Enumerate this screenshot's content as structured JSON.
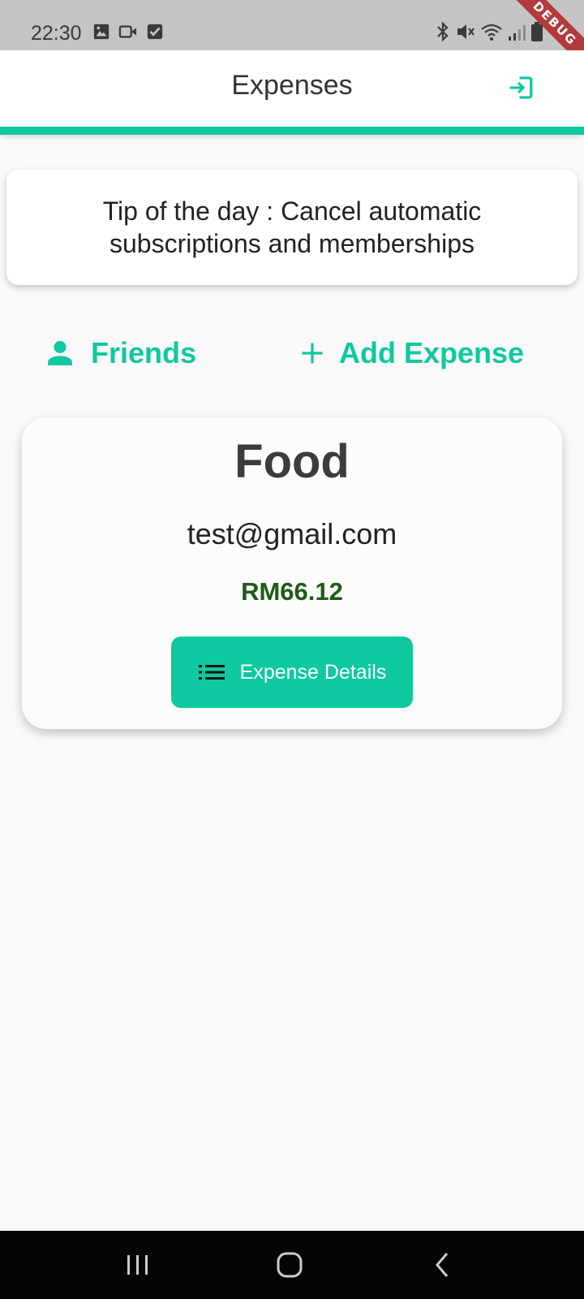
{
  "status_bar": {
    "time": "22:30",
    "debug_label": "DEBUG"
  },
  "app_bar": {
    "title": "Expenses",
    "logout_icon": "logout-icon"
  },
  "tip": {
    "text": "Tip of the day : Cancel automatic subscriptions and memberships"
  },
  "actions": {
    "friends_label": "Friends",
    "friends_icon": "person-icon",
    "add_expense_label": "Add Expense",
    "add_expense_icon": "plus-icon"
  },
  "expenses": [
    {
      "category": "Food",
      "email": "test@gmail.com",
      "amount": "RM66.12",
      "button_label": "Expense Details",
      "button_icon": "list-icon"
    }
  ],
  "colors": {
    "accent": "#0ec9a0",
    "amount": "#1f5b17",
    "status_bar": "#c4c4c4",
    "nav_bar": "#050505",
    "debug_banner": "#b23a3a"
  }
}
